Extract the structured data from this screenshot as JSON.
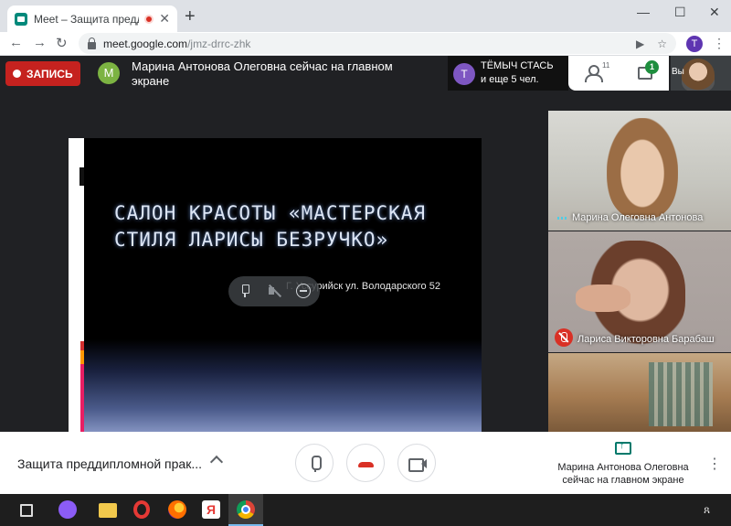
{
  "browser": {
    "tab_title": "Meet – Защита преддипломной",
    "tab_close": "✕",
    "new_tab": "+",
    "window_controls": {
      "minimize": "—",
      "maximize": "☐",
      "close": "✕"
    },
    "nav": {
      "back": "←",
      "forward": "→",
      "reload": "↻"
    },
    "url_host": "meet.google.com",
    "url_path": "/jmz-drrc-zhk",
    "profile_initial": "T",
    "menu_icon": "⋮",
    "omnibox_icons": {
      "camera": "▶",
      "star": "☆"
    }
  },
  "meet_header": {
    "record_label": "ЗАПИСЬ",
    "presenter_initial": "M",
    "presenter_status": "Марина Антонова Олеговна сейчас на главном экране",
    "participant_avatar_initial": "T",
    "participant_name": "ТЁМЫЧ СТАСЬ",
    "participant_more": "и еще 5 чел.",
    "people_count": "11",
    "chat_badge": "1",
    "self_label": "Вы"
  },
  "slide": {
    "title": "САЛОН КРАСОТЫ «МАСТЕРСКАЯ СТИЛЯ ЛАРИСЫ БЕЗРУЧКО»",
    "address": "Г. Уссурийск ул. Володарского 52"
  },
  "tiles": [
    {
      "name": "Марина Олеговна Антонова",
      "muted": false
    },
    {
      "name": "Лариса Викторовна Барабаш",
      "muted": true
    },
    {
      "name": "",
      "muted": false
    }
  ],
  "bottom_bar": {
    "meeting_name": "Защита преддипломной прак...",
    "presenting_status": "Марина Антонова Олеговна сейчас на главном экране",
    "more_icon": "⋮"
  },
  "taskbar": {
    "yandex_letter": "Я",
    "user_icon": "ጸ"
  },
  "colors": {
    "record": "#c5221f",
    "hangup": "#d93025",
    "chat_badge": "#1e8e3e",
    "presenter_avatar": "#7cb342",
    "participant_avatar": "#7e57c2",
    "profile": "#5e35b1"
  }
}
